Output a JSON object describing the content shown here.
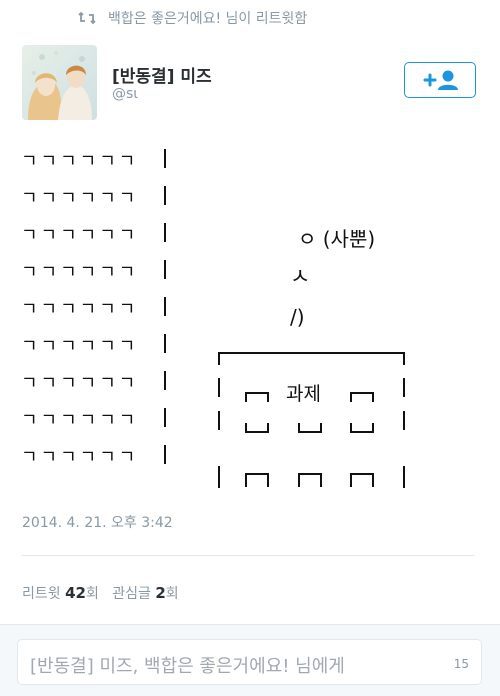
{
  "retweet_header": {
    "text": "백합은 좋은거에요! 님이 리트윗함",
    "icon": "retweet-icon"
  },
  "user": {
    "name": "[반동결] 미즈",
    "handle": "@sι",
    "avatar": "avatar-illustration"
  },
  "follow_button": {
    "icon": "add-user-icon",
    "accent": "#1b95e0"
  },
  "tweet": {
    "row_text": "ㄱㄱㄱㄱㄱㄱ",
    "rows_count": 9,
    "art": {
      "line1": "ㅇ (사뿐)",
      "line2": "ㅅ",
      "line3": "/)",
      "building_label": "과제"
    }
  },
  "timestamp": "2014. 4. 21. 오후 3:42",
  "stats": {
    "retweets_label": "리트윗",
    "retweets_count": "42",
    "retweets_unit": "회",
    "likes_label": "관심글",
    "likes_count": "2",
    "likes_unit": "회"
  },
  "reply": {
    "placeholder": "[반동결] 미즈, 백합은 좋은거에요! 님에게",
    "count": "15"
  }
}
